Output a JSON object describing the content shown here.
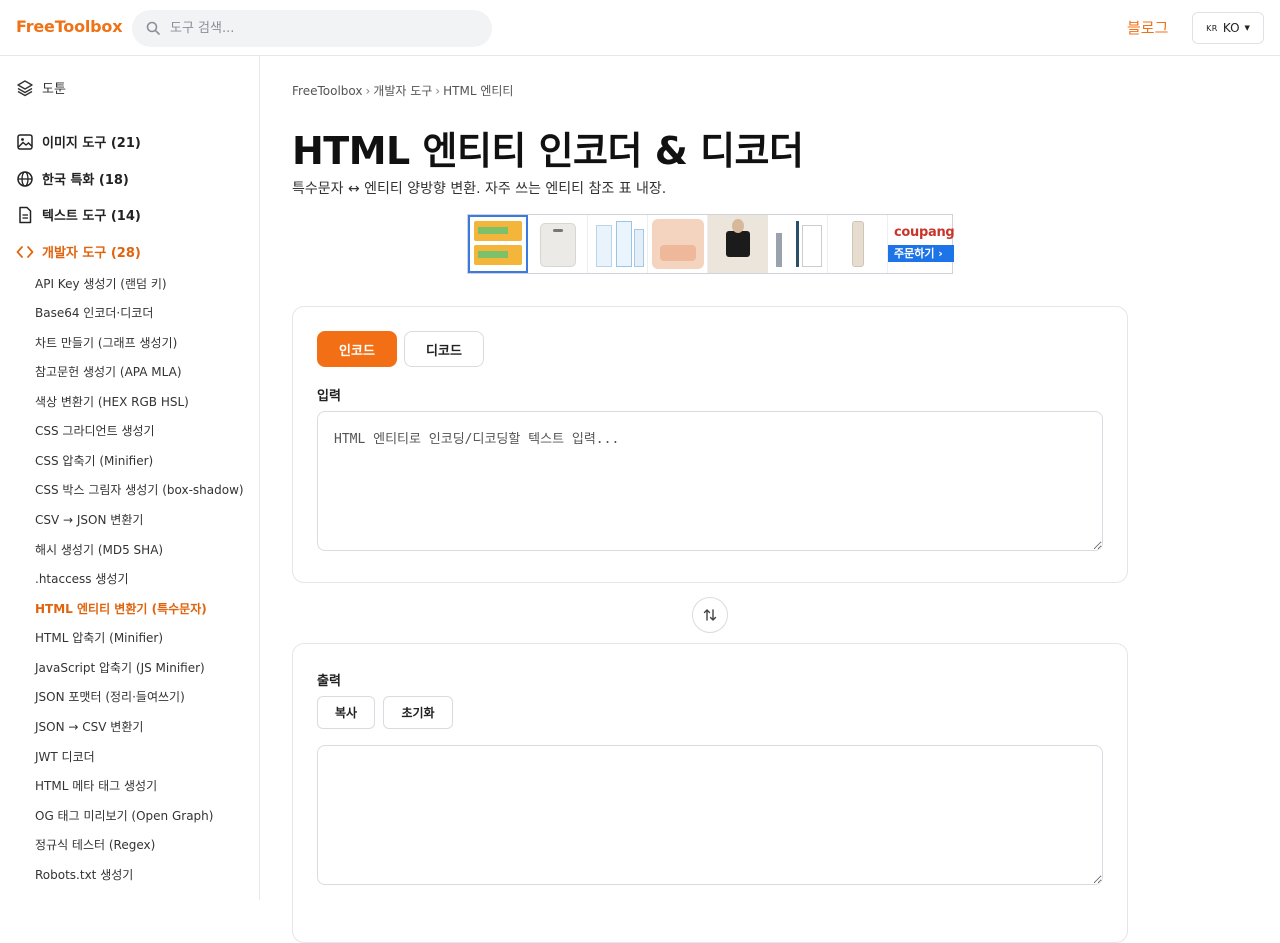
{
  "header": {
    "logo": "FreeToolbox",
    "search_placeholder": "도구 검색...",
    "blog_label": "블로그",
    "lang_flag": "KR",
    "lang_label": "KO"
  },
  "sidebar": {
    "top_item": "도툰",
    "categories": [
      {
        "label": "이미지 도구 (21)",
        "icon": "image-icon"
      },
      {
        "label": "한국 특화 (18)",
        "icon": "globe-icon"
      },
      {
        "label": "텍스트 도구 (14)",
        "icon": "document-icon"
      },
      {
        "label": "개발자 도구 (28)",
        "icon": "code-icon"
      }
    ],
    "dev_tools": [
      "API Key 생성기 (랜덤 키)",
      "Base64 인코더·디코더",
      "차트 만들기 (그래프 생성기)",
      "참고문헌 생성기 (APA MLA)",
      "색상 변환기 (HEX RGB HSL)",
      "CSS 그라디언트 생성기",
      "CSS 압축기 (Minifier)",
      "CSS 박스 그림자 생성기 (box-shadow)",
      "CSV → JSON 변환기",
      "해시 생성기 (MD5 SHA)",
      ".htaccess 생성기",
      "HTML 엔티티 변환기 (특수문자)",
      "HTML 압축기 (Minifier)",
      "JavaScript 압축기 (JS Minifier)",
      "JSON 포맷터 (정리·들여쓰기)",
      "JSON → CSV 변환기",
      "JWT 디코더",
      "HTML 메타 태그 생성기",
      "OG 태그 미리보기 (Open Graph)",
      "정규식 테스터 (Regex)",
      "Robots.txt 생성기"
    ]
  },
  "breadcrumb": [
    "FreeToolbox",
    "개발자 도구",
    "HTML 엔티티"
  ],
  "page": {
    "title": "HTML 엔티티 인코더 & 디코더",
    "subtitle": "특수문자 ↔ 엔티티 양방향 변환. 자주 쓰는 엔티티 참조 표 내장."
  },
  "ad": {
    "brand": "coupang",
    "cta": "주문하기 ›"
  },
  "input_card": {
    "tab_encode": "인코드",
    "tab_decode": "디코드",
    "label": "입력",
    "placeholder": "HTML 엔티티로 인코딩/디코딩할 텍스트 입력...",
    "value": ""
  },
  "output_card": {
    "label": "출력",
    "copy_label": "복사",
    "reset_label": "초기화",
    "value": ""
  },
  "colors": {
    "accent": "#f36f15",
    "active_text": "#e0640e"
  }
}
